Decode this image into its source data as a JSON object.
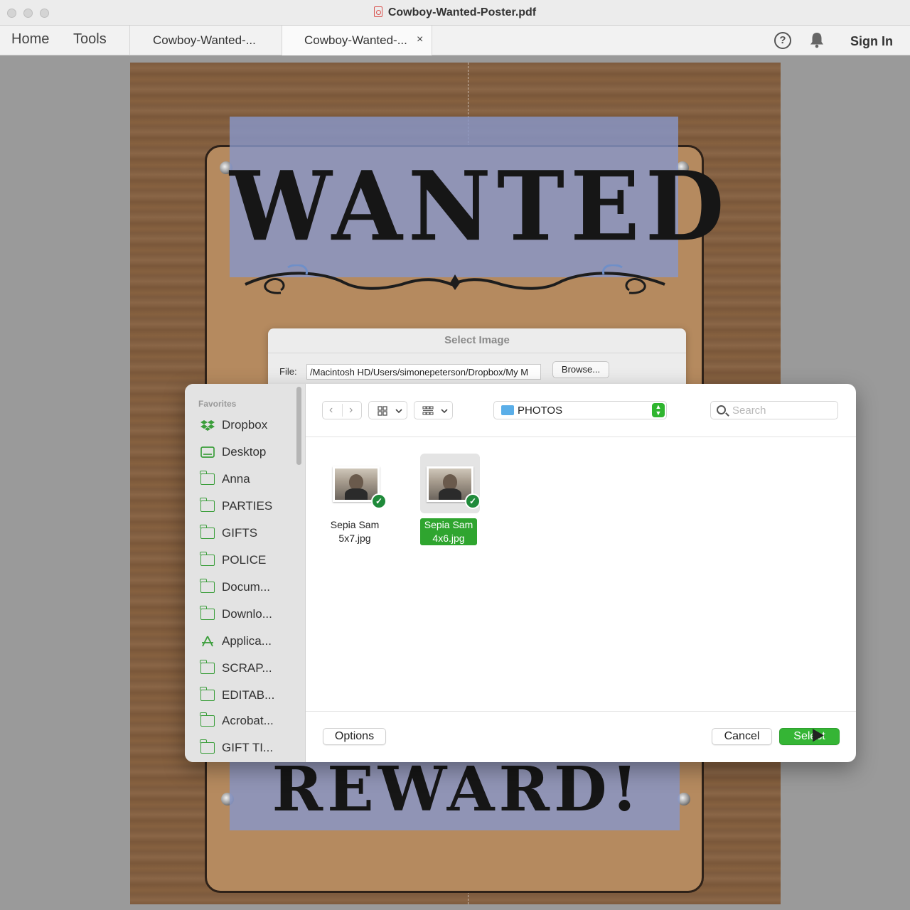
{
  "window": {
    "title": "Cowboy-Wanted-Poster.pdf"
  },
  "toolbar": {
    "home": "Home",
    "tools": "Tools",
    "tabs": [
      "Cowboy-Wanted-...",
      "Cowboy-Wanted-..."
    ],
    "tab_close": "×",
    "help": "?",
    "sign_in": "Sign In"
  },
  "poster": {
    "title": "WANTED",
    "reward": "REWARD!"
  },
  "select_image_dialog": {
    "title": "Select Image",
    "file_label": "File:",
    "file_value": "/Macintosh HD/Users/simonepeterson/Dropbox/My M",
    "browse": "Browse..."
  },
  "picker": {
    "favorites_header": "Favorites",
    "sidebar": [
      {
        "label": "Dropbox",
        "icon": "dropbox-icon"
      },
      {
        "label": "Desktop",
        "icon": "desktop-icon"
      },
      {
        "label": "Anna",
        "icon": "folder-icon"
      },
      {
        "label": "PARTIES",
        "icon": "folder-icon"
      },
      {
        "label": "GIFTS",
        "icon": "folder-icon"
      },
      {
        "label": "POLICE",
        "icon": "folder-icon"
      },
      {
        "label": "Docum...",
        "icon": "folder-icon"
      },
      {
        "label": "Downlo...",
        "icon": "folder-icon"
      },
      {
        "label": "Applica...",
        "icon": "applications-icon"
      },
      {
        "label": "SCRAP...",
        "icon": "folder-icon"
      },
      {
        "label": "EDITAB...",
        "icon": "folder-icon"
      },
      {
        "label": "Acrobat...",
        "icon": "folder-icon"
      },
      {
        "label": "GIFT TI...",
        "icon": "folder-icon"
      }
    ],
    "location": "PHOTOS",
    "search_placeholder": "Search",
    "files": [
      {
        "line1": "Sepia Sam",
        "line2": "5x7.jpg",
        "selected": false
      },
      {
        "line1": "Sepia Sam",
        "line2": "4x6.jpg",
        "selected": true
      }
    ],
    "options": "Options",
    "cancel": "Cancel",
    "select": "Select"
  },
  "colors": {
    "accent_green": "#35b535",
    "folder_blue": "#5aaee8",
    "overlay_blue": "#8796c8"
  }
}
